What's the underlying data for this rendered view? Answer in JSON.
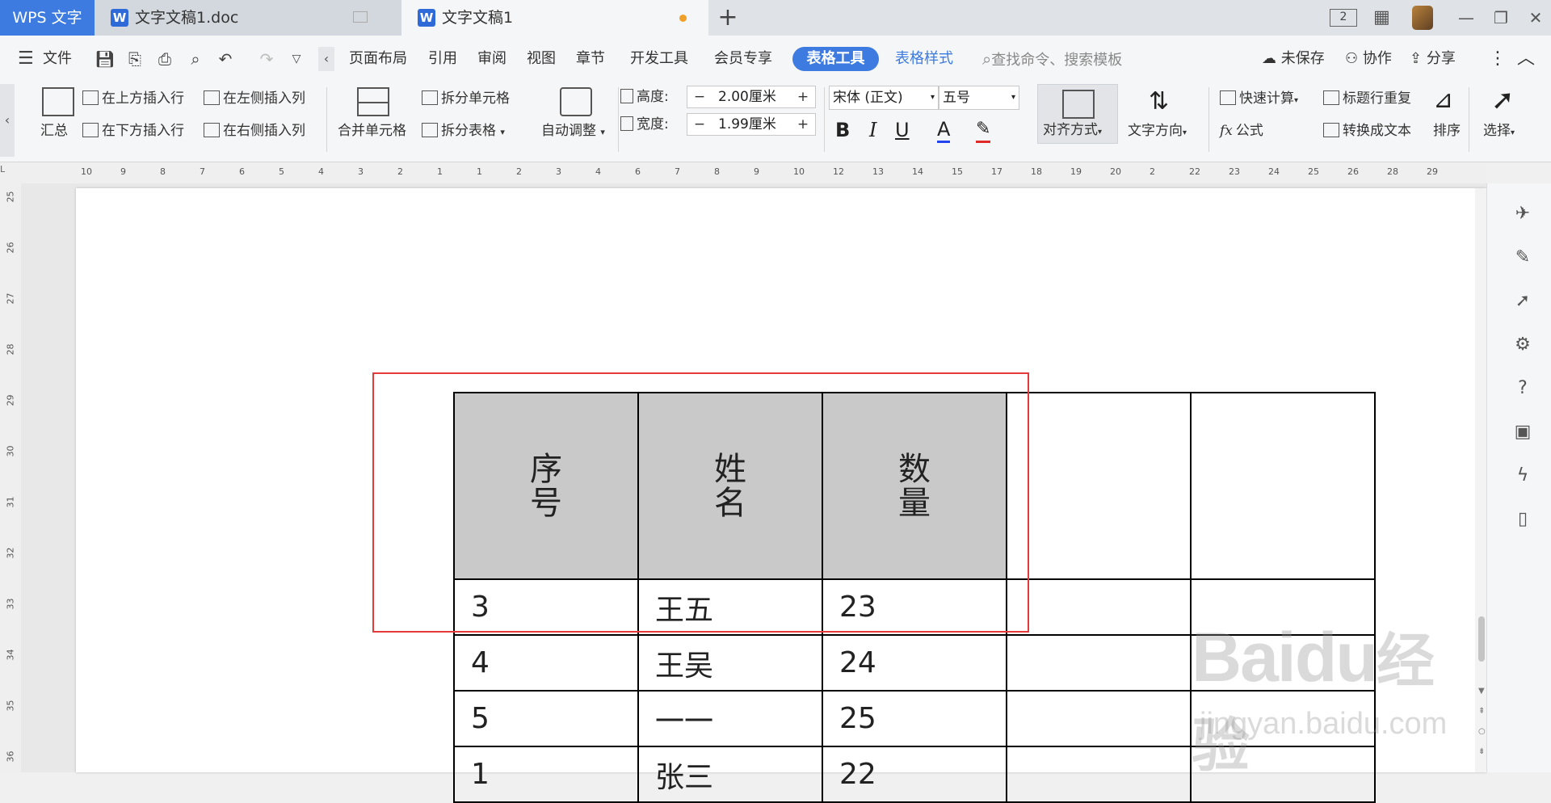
{
  "window": {
    "app_tab": "WPS 文字",
    "tabs": [
      {
        "label": "文字文稿1.doc",
        "icon": "wps-writer-icon"
      },
      {
        "label": "文字文稿1",
        "icon": "wps-writer-icon",
        "modified": true
      }
    ],
    "new_tab": "+",
    "page_badge": "2"
  },
  "menubar": {
    "file_label": "文件",
    "items": [
      "页面布局",
      "引用",
      "审阅",
      "视图",
      "章节",
      "开发工具",
      "会员专享"
    ],
    "active_tab": "表格工具",
    "style_tab": "表格样式",
    "search_placeholder": "查找命令、搜索模板",
    "unsaved": "未保存",
    "collaborate": "协作",
    "share": "分享"
  },
  "ribbon": {
    "summary": "汇总",
    "insert_above": "在上方插入行",
    "insert_below": "在下方插入行",
    "insert_left": "在左侧插入列",
    "insert_right": "在右侧插入列",
    "merge_cells": "合并单元格",
    "split_cells": "拆分单元格",
    "split_table": "拆分表格",
    "auto_fit": "自动调整",
    "height_label": "高度:",
    "height_value": "2.00厘米",
    "width_label": "宽度:",
    "width_value": "1.99厘米",
    "font_name": "宋体 (正文)",
    "font_size": "五号",
    "bold": "B",
    "italic": "I",
    "underline": "U",
    "font_color": "A",
    "align": "对齐方式",
    "text_direction": "文字方向",
    "quick_calc": "快速计算",
    "formula": "公式",
    "repeat_header": "标题行重复",
    "convert_text": "转换成文本",
    "sort": "排序",
    "select": "选择"
  },
  "ruler": {
    "h_ticks": [
      "10",
      "9",
      "8",
      "7",
      "6",
      "5",
      "4",
      "3",
      "2",
      "1",
      "1",
      "2",
      "3",
      "4",
      "6",
      "7",
      "8",
      "9",
      "10",
      "12",
      "13",
      "14",
      "15",
      "17",
      "18",
      "19",
      "20",
      "2",
      "22",
      "23",
      "24",
      "25",
      "26",
      "28",
      "29"
    ],
    "v_ticks": [
      "25",
      "26",
      "27",
      "28",
      "29",
      "30",
      "31",
      "32",
      "33",
      "34",
      "35",
      "36"
    ]
  },
  "table": {
    "header": [
      {
        "line1": "序",
        "line2": "号"
      },
      {
        "line1": "姓",
        "line2": "名"
      },
      {
        "line1": "数",
        "line2": "量"
      },
      {
        "line1": "",
        "line2": ""
      },
      {
        "line1": "",
        "line2": ""
      }
    ],
    "rows": [
      [
        "3",
        "王五",
        "23",
        "",
        ""
      ],
      [
        "4",
        "王吴",
        "24",
        "",
        ""
      ],
      [
        "5",
        "一一",
        "25",
        "",
        ""
      ],
      [
        "1",
        "张三",
        "22",
        "",
        ""
      ]
    ]
  },
  "watermark": {
    "brand": "Bai",
    "paw": "du",
    "cn": "经验",
    "url": "jingyan.baidu.com"
  },
  "colors": {
    "accent": "#3d7be0",
    "highlight_box": "#e53a3a",
    "header_fill": "#c9c9c9"
  }
}
